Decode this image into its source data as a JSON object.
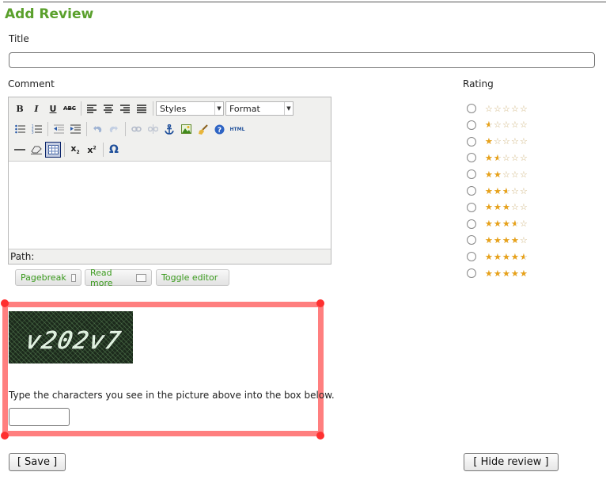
{
  "heading": "Add Review",
  "labels": {
    "title": "Title",
    "comment": "Comment",
    "rating": "Rating"
  },
  "title_input": {
    "value": "",
    "placeholder": ""
  },
  "editor": {
    "styles_select": "Styles",
    "format_select": "Format",
    "path_label": "Path:",
    "toolbar_row1": [
      "bold-icon",
      "italic-icon",
      "underline-icon",
      "strikethrough-icon",
      "align-left-icon",
      "align-center-icon",
      "align-right-icon",
      "align-justify-icon"
    ],
    "toolbar_row2": [
      "bullet-list-icon",
      "numbered-list-icon",
      "outdent-icon",
      "indent-icon",
      "undo-icon",
      "redo-icon",
      "link-icon",
      "unlink-icon",
      "anchor-icon",
      "image-icon",
      "cleanup-icon",
      "help-icon",
      "html-icon"
    ],
    "toolbar_row3": [
      "horizontal-rule-icon",
      "remove-format-icon",
      "visual-aid-icon",
      "subscript-icon",
      "superscript-icon",
      "special-char-icon"
    ],
    "html_label": "HTML",
    "omega": "Ω"
  },
  "editor_buttons": {
    "pagebreak": "Pagebreak",
    "read_more": "Read more",
    "toggle_editor": "Toggle editor"
  },
  "captcha": {
    "image_text": "v202v7",
    "instruction": "Type the characters you see in the picture above into the box below.",
    "input_value": ""
  },
  "rating": {
    "options": [
      0,
      0.5,
      1,
      1.5,
      2,
      2.5,
      3,
      3.5,
      4,
      4.5,
      5
    ],
    "max_stars": 5,
    "selected": null
  },
  "buttons": {
    "save": "[ Save ]",
    "hide_review": "[ Hide review ]"
  },
  "colors": {
    "heading": "#5aa02c",
    "editor_button_text": "#3b9a1e",
    "highlight_frame": "#ff7f7f",
    "star_fill": "#e8a21a"
  }
}
